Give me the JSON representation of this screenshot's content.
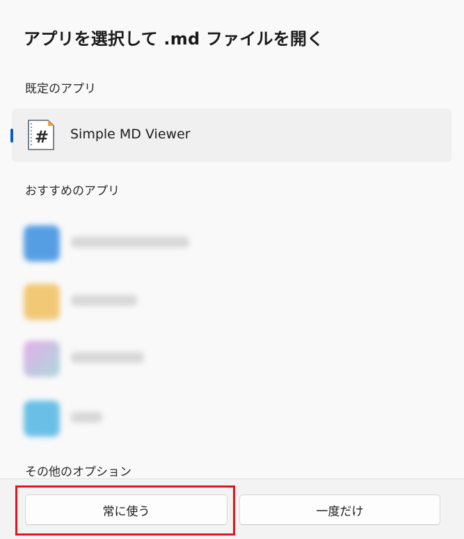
{
  "dialog": {
    "title": "アプリを選択して .md ファイルを開く",
    "default_section_label": "既定のアプリ",
    "default_app": {
      "name": "Simple MD Viewer",
      "icon": "markdown-file-icon"
    },
    "recommended_section_label": "おすすめのアプリ",
    "recommended_apps": [
      {
        "icon": "blurred-app-icon",
        "color": "#3a8fe0"
      },
      {
        "icon": "blurred-app-icon",
        "color": "#f0c060"
      },
      {
        "icon": "blurred-app-icon",
        "color": "#9fd3d6"
      },
      {
        "icon": "blurred-app-icon",
        "color": "#52b6e3"
      }
    ],
    "other_options_label": "その他のオプション"
  },
  "footer": {
    "always_button_label": "常に使う",
    "once_button_label": "一度だけ"
  },
  "colors": {
    "accent": "#0a5fb4",
    "highlight_box": "#e3141b"
  }
}
